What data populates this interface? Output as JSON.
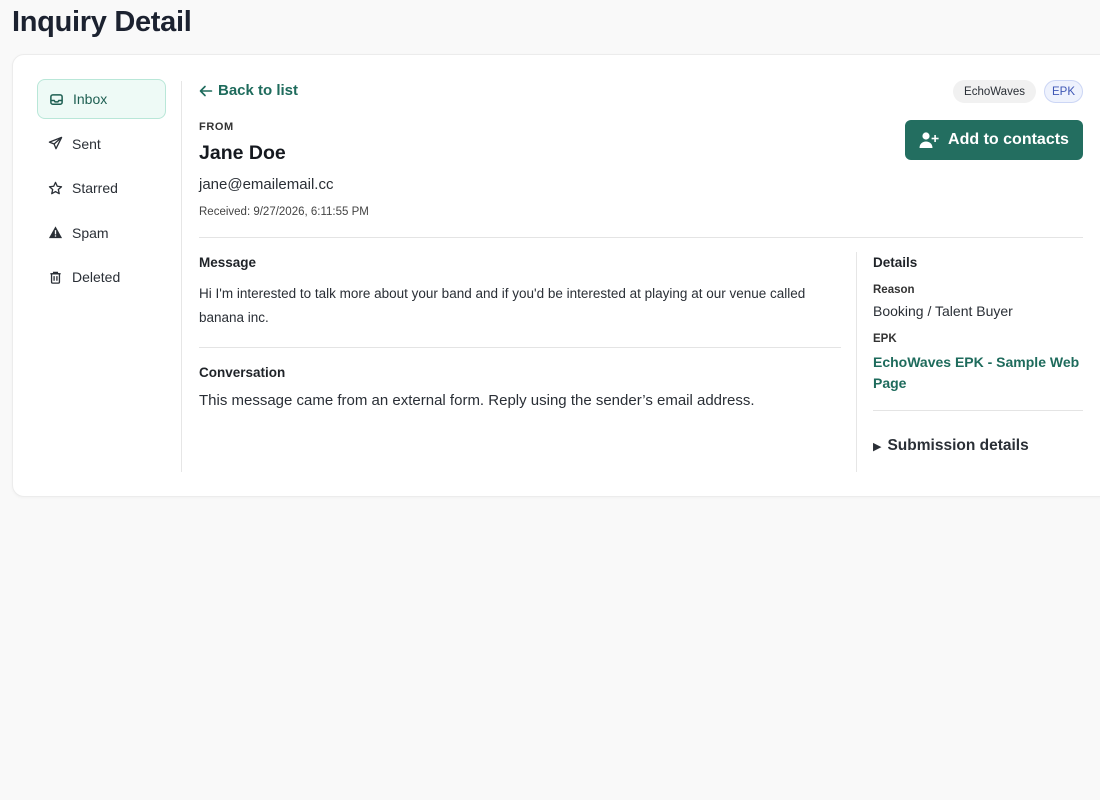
{
  "page": {
    "title": "Inquiry Detail"
  },
  "sidebar": {
    "items": [
      {
        "label": "Inbox",
        "icon": "inbox-icon",
        "active": true
      },
      {
        "label": "Sent",
        "icon": "send-icon",
        "active": false
      },
      {
        "label": "Starred",
        "icon": "star-icon",
        "active": false
      },
      {
        "label": "Spam",
        "icon": "warning-icon",
        "active": false
      },
      {
        "label": "Deleted",
        "icon": "trash-icon",
        "active": false
      }
    ]
  },
  "header": {
    "back_label": "Back to list",
    "badges": [
      "EchoWaves",
      "EPK"
    ],
    "add_contact_label": "Add to contacts"
  },
  "sender": {
    "from_label": "FROM",
    "name": "Jane Doe",
    "email": "jane@emailemail.cc",
    "received": "Received: 9/27/2026, 6:11:55 PM"
  },
  "message": {
    "title": "Message",
    "body": "Hi I'm interested to talk more about your band and if you'd be interested at playing at our venue called banana inc."
  },
  "conversation": {
    "title": "Conversation",
    "body": "This message came from an external form. Reply using the sender’s email address."
  },
  "details": {
    "title": "Details",
    "reason_label": "Reason",
    "reason_value": "Booking / Talent Buyer",
    "epk_label": "EPK",
    "epk_link": "EchoWaves EPK - Sample Web Page",
    "submission_label": "Submission details"
  },
  "colors": {
    "accent": "#236e60",
    "link": "#1e6b5c",
    "active_bg": "#eefaf6",
    "badge_blue": "#3f57b5"
  }
}
